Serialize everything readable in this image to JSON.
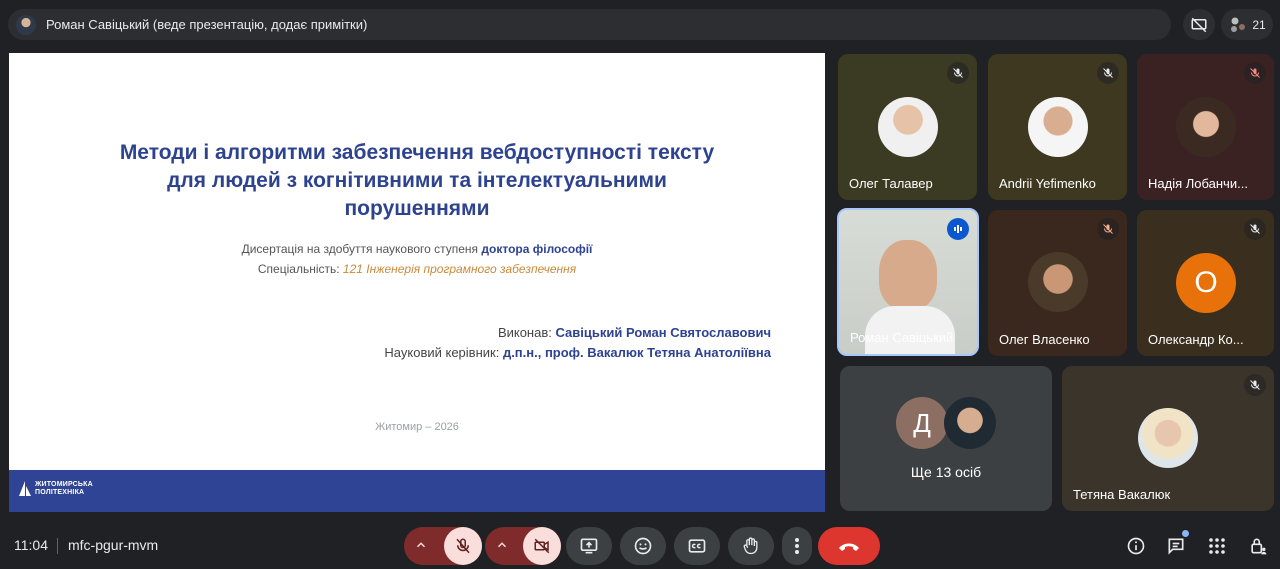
{
  "header": {
    "presenter_text": "Роман Савіцький (веде презентацію, додає примітки)",
    "participants_count": "21"
  },
  "slide": {
    "title_line1": "Методи і алгоритми забезпечення вебдоступності тексту",
    "title_line2": "для людей з когнітивними та інтелектуальними",
    "title_line3": "порушеннями",
    "degree_prefix": "Дисертація на здобуття наукового ступеня",
    "degree_bold": "доктора філософії",
    "spec_label": "Спеціальність:",
    "spec_value": "121 Інженерія програмного забезпечення",
    "author_label": "Виконав:",
    "author_name": "Савіцький Роман Святославович",
    "advisor_label": "Науковий керівник:",
    "advisor_name": "д.п.н., проф. Вакалюк Тетяна Анатоліївна",
    "city_year": "Житомир – 2026",
    "logo_line1": "ЖИТОМИРСЬКА",
    "logo_line2": "ПОЛІТЕХНІКА"
  },
  "participants": [
    {
      "name": "Олег Талавер",
      "muted": true,
      "bg": "#3b3a22"
    },
    {
      "name": "Andrii Yefimenko",
      "muted": true,
      "bg": "#3e3821"
    },
    {
      "name": "Надія Лобанчи...",
      "muted": true,
      "bg": "#3a2222"
    },
    {
      "name": "Роман Савіцький",
      "speaking": true
    },
    {
      "name": "Олег Власенко",
      "muted": true,
      "bg": "#3a271e"
    },
    {
      "name": "Олександр Ко...",
      "muted": true,
      "bg": "#3a2f1e",
      "initial": "О",
      "color": "#e8710a"
    },
    {
      "name": "Ще 13 осіб",
      "initial": "Д",
      "color": "#8d6e63"
    },
    {
      "name": "Тетяна Вакалюк",
      "muted": true,
      "bg": "#3b342a"
    }
  ],
  "bottom": {
    "time": "11:04",
    "meeting_code": "mfc-pgur-mvm"
  }
}
